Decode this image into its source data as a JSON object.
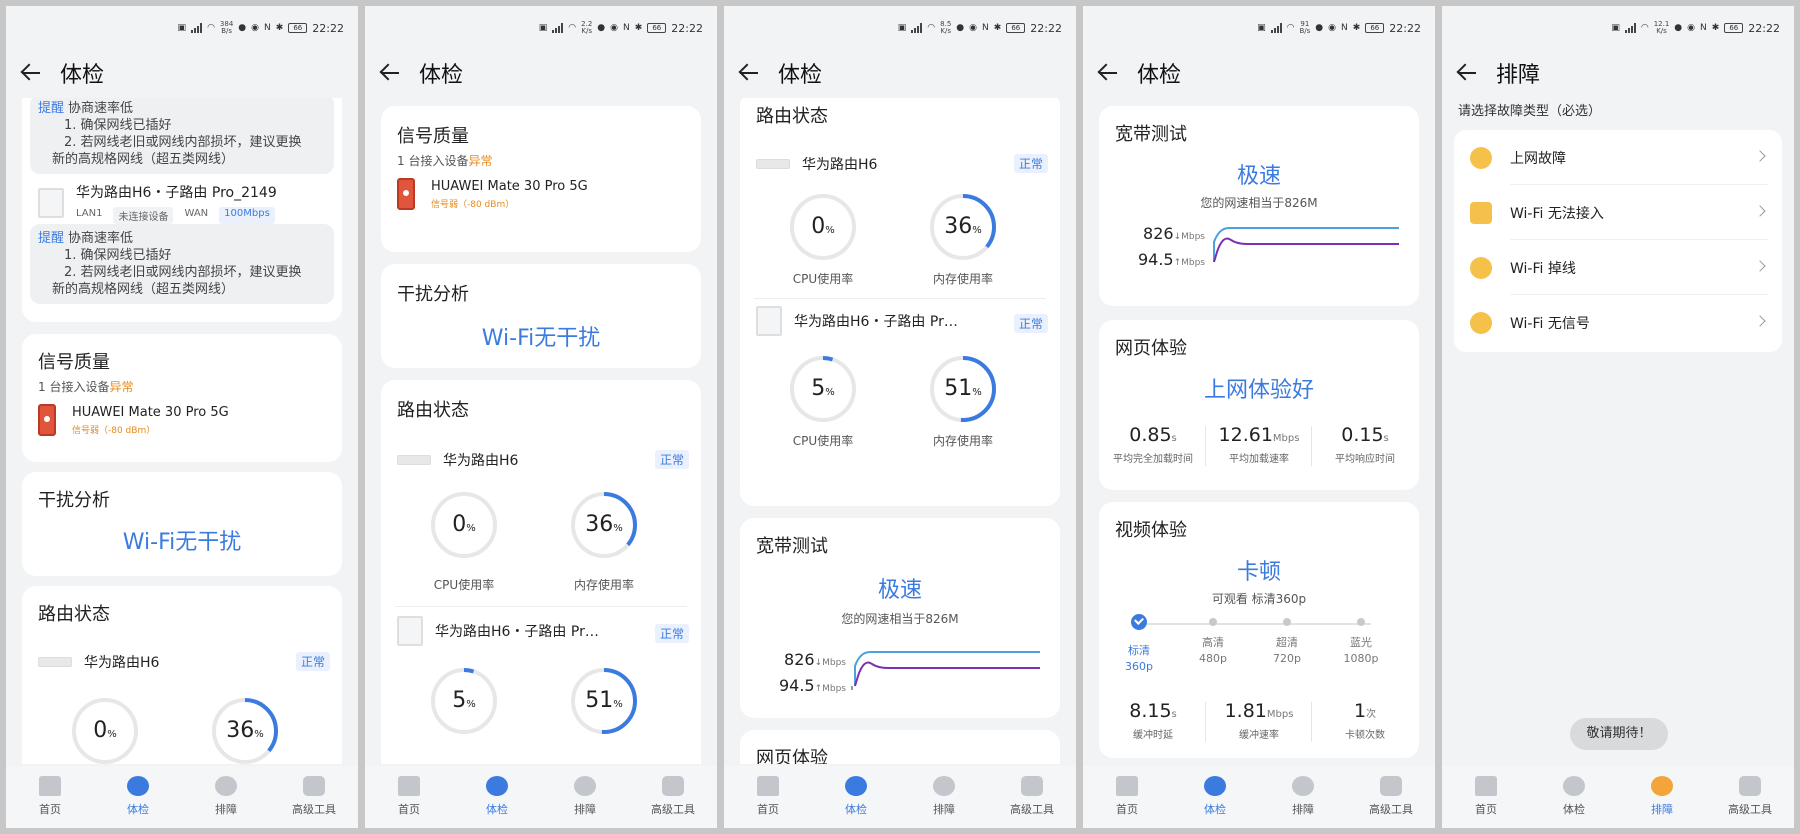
{
  "status": {
    "time": "22:22",
    "battery": "66"
  },
  "screens": [
    {
      "speed_top": "384",
      "speed_unit": "B/s"
    },
    {
      "speed_top": "2.2",
      "speed_unit": "K/s"
    },
    {
      "speed_top": "8.5",
      "speed_unit": "K/s"
    },
    {
      "speed_top": "91",
      "speed_unit": "B/s"
    },
    {
      "speed_top": "12.1",
      "speed_unit": "K/s"
    }
  ],
  "header": {
    "checkup_title": "体检",
    "trouble_title": "排障"
  },
  "notes": {
    "tag": "提醒",
    "title": "协商速率低",
    "line1": "1. 确保网线已插好",
    "line2": "2. 若网线老旧或网线内部损坏，建议更换",
    "line3": "新的高规格网线（超五类网线）"
  },
  "subrouter": {
    "name": "华为路由H6・子路由 Pro_2149",
    "name_short": "华为路由H6・子路由 Pr…",
    "lan": "LAN1",
    "lan_state": "未连接设备",
    "wan": "WAN",
    "wan_rate": "100Mbps"
  },
  "signal": {
    "title": "信号质量",
    "count_prefix": "1 台接入设备",
    "count_state": "异常",
    "device": "HUAWEI Mate 30 Pro 5G",
    "device_sub": "信号弱（-80 dBm）"
  },
  "interference": {
    "title": "干扰分析",
    "result": "Wi-Fi无干扰"
  },
  "router": {
    "title": "路由状态",
    "main_name": "华为路由H6",
    "status": "正常",
    "main_cpu": 0,
    "main_mem": 36,
    "sub_cpu": 5,
    "sub_mem": 51,
    "cpu_label": "CPU使用率",
    "mem_label": "内存使用率",
    "pct": "%"
  },
  "broadband": {
    "title": "宽带测试",
    "result": "极速",
    "desc": "您的网速相当于826M",
    "down": "826",
    "down_unit": "↓Mbps",
    "up": "94.5",
    "up_unit": "↑Mbps"
  },
  "web": {
    "title": "网页体验",
    "result": "上网体验好",
    "m1": "0.85",
    "m1_unit": "s",
    "m1_label": "平均完全加载时间",
    "m2": "12.61",
    "m2_unit": "Mbps",
    "m2_label": "平均加载速率",
    "m3": "0.15",
    "m3_unit": "s",
    "m3_label": "平均响应时间"
  },
  "video": {
    "title": "视频体验",
    "result": "卡顿",
    "desc": "可观看 标清360p",
    "steps": [
      {
        "name": "标清",
        "res": "360p"
      },
      {
        "name": "高清",
        "res": "480p"
      },
      {
        "name": "超清",
        "res": "720p"
      },
      {
        "name": "蓝光",
        "res": "1080p"
      }
    ],
    "m1": "8.15",
    "m1_unit": "s",
    "m1_label": "缓冲时延",
    "m2": "1.81",
    "m2_unit": "Mbps",
    "m2_label": "缓冲速率",
    "m3": "1",
    "m3_unit": "次",
    "m3_label": "卡顿次数"
  },
  "trouble": {
    "prompt": "请选择故障类型（必选）",
    "items": [
      "上网故障",
      "Wi-Fi 无法接入",
      "Wi-Fi 掉线",
      "Wi-Fi 无信号"
    ],
    "toast": "敬请期待！"
  },
  "nav": {
    "home": "首页",
    "checkup": "体检",
    "trouble": "排障",
    "tools": "高级工具"
  },
  "colors": {
    "accent": "#3b7be0",
    "warn": "#e8891a",
    "down_line": "#4aa3e0",
    "up_line": "#7b2fb3"
  }
}
